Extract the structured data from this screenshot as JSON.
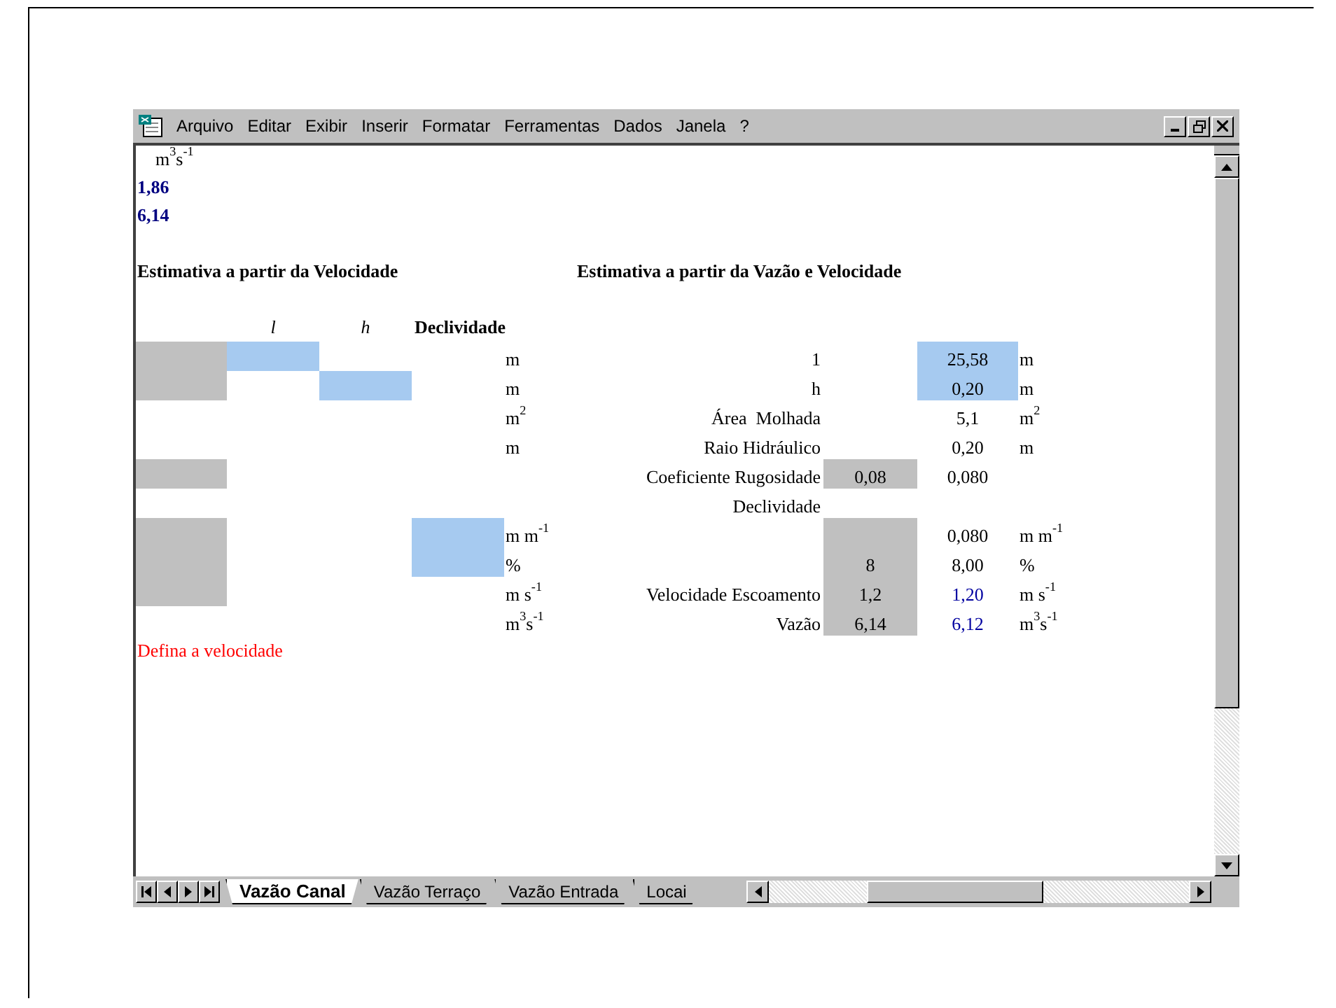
{
  "menu": [
    "Arquivo",
    "Editar",
    "Exibir",
    "Inserir",
    "Formatar",
    "Ferramentas",
    "Dados",
    "Janela",
    "?"
  ],
  "top_cells": [
    {
      "text": "m$^{3}$s$^{-1}$",
      "kind": "unit"
    },
    {
      "text": "1,86",
      "kind": "result"
    },
    {
      "text": "6,14",
      "kind": "result"
    }
  ],
  "left_heading": "Estimativa a partir da Velocidade",
  "right_heading": "Estimativa a partir da Vazão e Velocidade",
  "column_headers": [
    {
      "text": "l",
      "kind": "symbol"
    },
    {
      "text": "h",
      "kind": "symbol"
    },
    {
      "text": "Declividade",
      "kind": "title"
    }
  ],
  "sheet_rows": [
    {
      "left_cells": [
        {
          "kind": "shaded"
        },
        {
          "kind": "input"
        },
        {
          "kind": "blank"
        },
        {
          "kind": "blank"
        }
      ],
      "left_unit": "m",
      "label": "1",
      "input": {
        "kind": "blank"
      },
      "value": {
        "text": "25,58",
        "kind": "input"
      },
      "unit": "m"
    },
    {
      "left_cells": [
        {
          "kind": "shaded"
        },
        {
          "kind": "blank"
        },
        {
          "kind": "input"
        },
        {
          "kind": "blank"
        }
      ],
      "left_unit": "m",
      "label": "h",
      "input": {
        "kind": "blank"
      },
      "value": {
        "text": "0,20",
        "kind": "input"
      },
      "unit": "m"
    },
    {
      "left_cells": [
        {
          "kind": "blank"
        },
        {
          "kind": "blank"
        },
        {
          "kind": "blank"
        },
        {
          "kind": "blank"
        }
      ],
      "left_unit": "m$^{2}$",
      "label": "Área  Molhada",
      "input": {
        "kind": "blank"
      },
      "value": {
        "text": "5,1",
        "kind": "plain"
      },
      "unit": "m$^{2}$"
    },
    {
      "left_cells": [
        {
          "kind": "blank"
        },
        {
          "kind": "blank"
        },
        {
          "kind": "blank"
        },
        {
          "kind": "blank"
        }
      ],
      "left_unit": "m",
      "label": "Raio Hidráulico",
      "input": {
        "kind": "blank"
      },
      "value": {
        "text": "0,20",
        "kind": "plain"
      },
      "unit": "m"
    },
    {
      "left_cells": [
        {
          "kind": "shaded"
        },
        {
          "kind": "blank"
        },
        {
          "kind": "blank"
        },
        {
          "kind": "blank"
        }
      ],
      "label": "Coeficiente Rugosidade",
      "input": {
        "text": "0,08",
        "kind": "shaded"
      },
      "value": {
        "text": "0,080",
        "kind": "plain"
      }
    },
    {
      "left_cells": [
        {
          "kind": "blank"
        },
        {
          "kind": "blank"
        },
        {
          "kind": "blank"
        },
        {
          "kind": "blank"
        }
      ],
      "label": "Declividade",
      "input": {
        "kind": "blank"
      },
      "value": {
        "kind": "blank"
      }
    },
    {
      "left_cells": [
        {
          "kind": "shaded"
        },
        {
          "kind": "blank"
        },
        {
          "kind": "blank"
        },
        {
          "kind": "input"
        }
      ],
      "left_unit": "m m$^{-1}$",
      "input": {
        "kind": "shaded"
      },
      "value": {
        "text": "0,080",
        "kind": "plain"
      },
      "unit": "m m$^{-1}$"
    },
    {
      "left_cells": [
        {
          "kind": "shaded"
        },
        {
          "kind": "blank"
        },
        {
          "kind": "blank"
        },
        {
          "kind": "input"
        }
      ],
      "left_unit": "%",
      "input": {
        "text": "8",
        "kind": "shaded"
      },
      "value": {
        "text": "8,00",
        "kind": "plain"
      },
      "unit": "%"
    },
    {
      "left_cells": [
        {
          "kind": "shaded"
        },
        {
          "kind": "blank"
        },
        {
          "kind": "blank"
        },
        {
          "kind": "blank"
        }
      ],
      "left_unit": "m s$^{-1}$",
      "label": "Velocidade Escoamento",
      "input": {
        "text": "1,2",
        "kind": "shaded"
      },
      "value": {
        "text": "1,20",
        "kind": "result"
      },
      "unit": "m s$^{-1}$"
    },
    {
      "left_cells": [
        {
          "kind": "blank"
        },
        {
          "kind": "blank"
        },
        {
          "kind": "blank"
        },
        {
          "kind": "blank"
        }
      ],
      "left_unit": "m$^{3}$s$^{-1}$",
      "label": "Vazão",
      "input": {
        "text": "6,14",
        "kind": "shaded"
      },
      "value": {
        "text": "6,12",
        "kind": "result"
      },
      "unit": "m$^{3}$s$^{-1}$"
    }
  ],
  "message": "Defina a velocidade",
  "sheet_tabs": [
    {
      "label": "Vazão Canal",
      "selected": true
    },
    {
      "label": "Vazão Terraço",
      "selected": false
    },
    {
      "label": "Vazão Entrada",
      "selected": false
    },
    {
      "label": "Locai",
      "selected": false
    }
  ]
}
